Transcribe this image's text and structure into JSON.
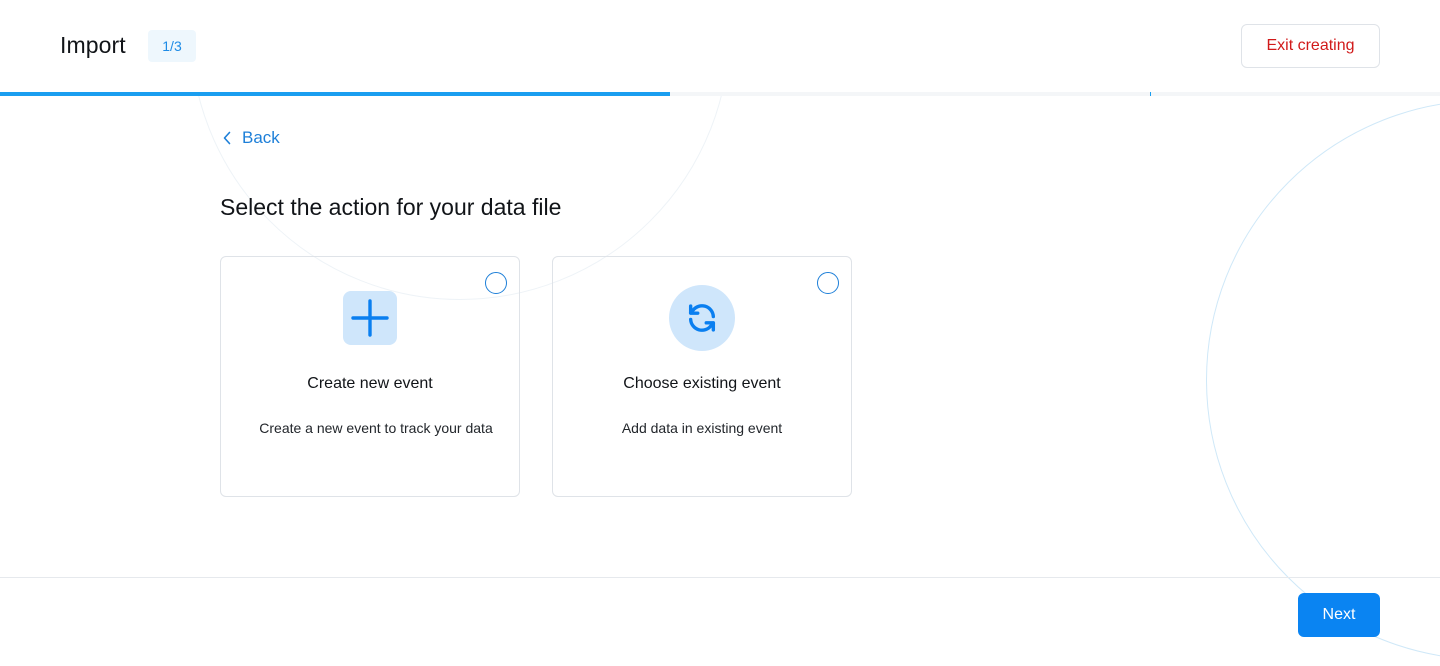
{
  "header": {
    "title": "Import",
    "step": "1/3",
    "exit_label": "Exit creating"
  },
  "progress": {
    "fraction": 0.4653
  },
  "nav": {
    "back_label": "Back",
    "back_icon": "chevron-left-icon"
  },
  "main": {
    "heading": "Select the action for your data file",
    "options": [
      {
        "title": "Create new event",
        "description": "Create a new event to track your data",
        "icon": "plus-icon",
        "selected": false
      },
      {
        "title": "Choose existing event",
        "description": "Add data in existing event",
        "icon": "refresh-icon",
        "selected": false
      }
    ]
  },
  "footer": {
    "next_label": "Next"
  },
  "colors": {
    "accent": "#0a84f2",
    "progress": "#1a9ef0",
    "danger": "#d11a1a",
    "icon_bg": "#cfe6fb"
  }
}
